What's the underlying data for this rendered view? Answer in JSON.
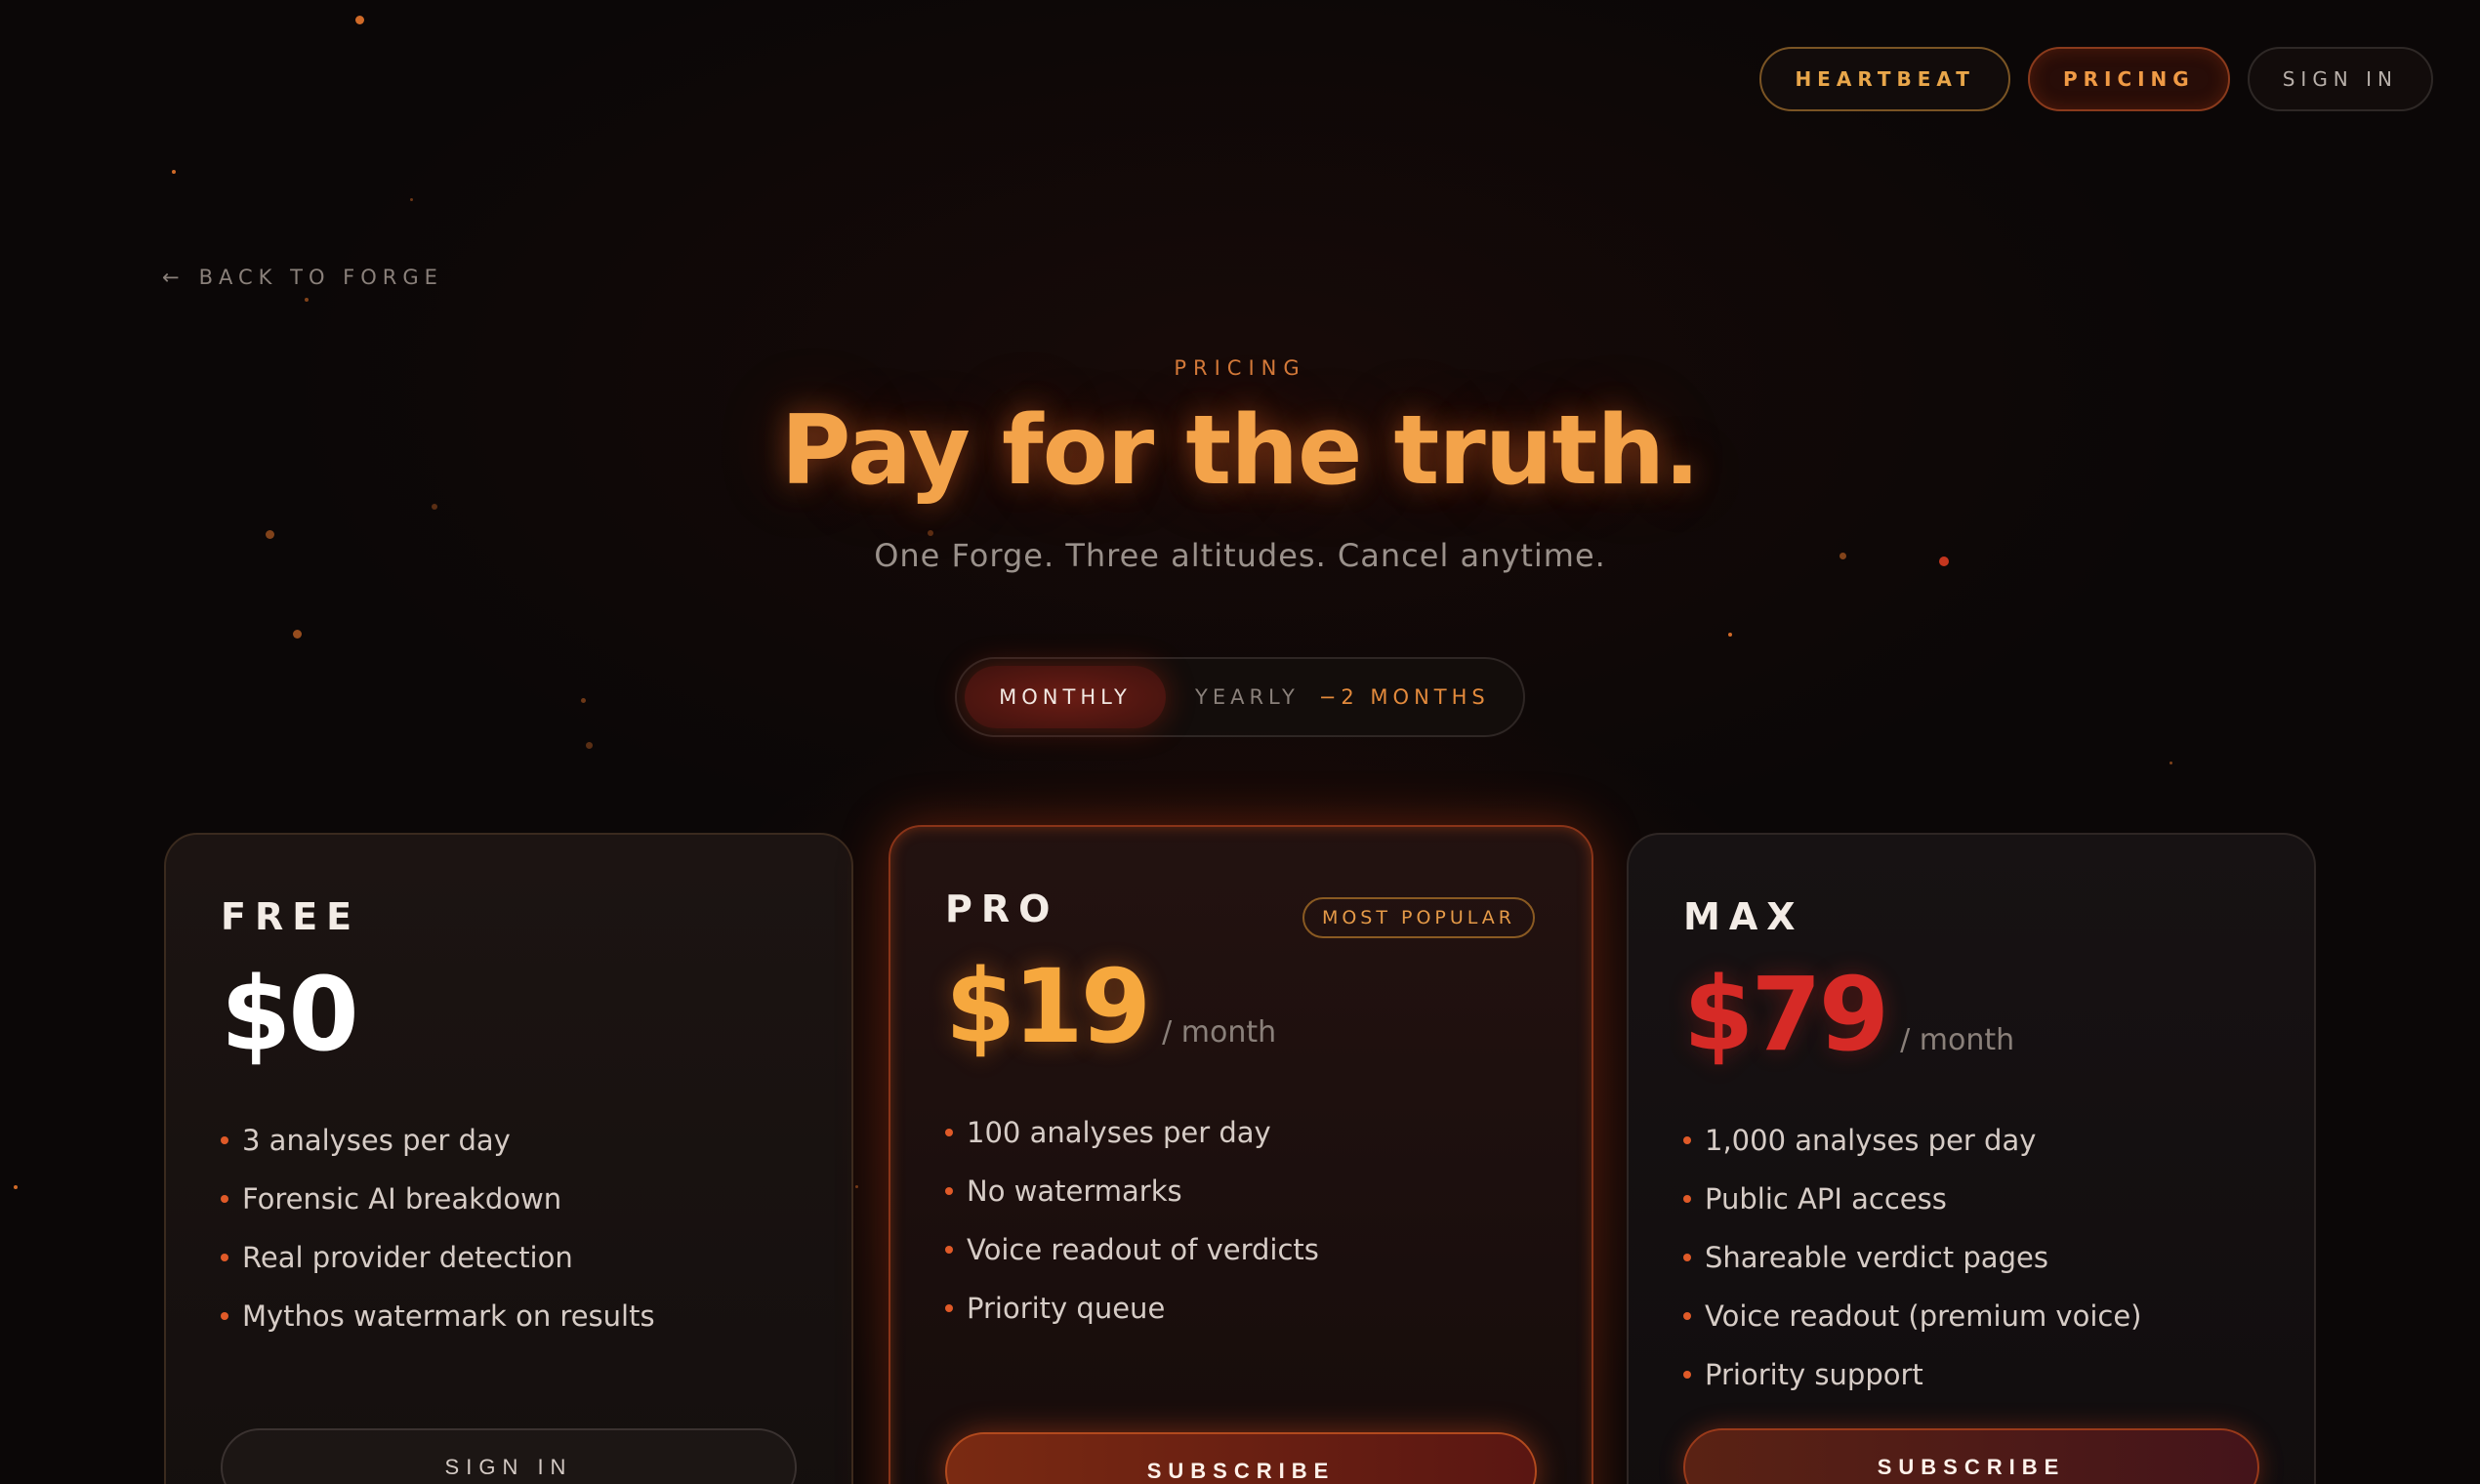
{
  "nav": {
    "heartbeat": "HEARTBEAT",
    "pricing": "PRICING",
    "signin": "SIGN IN"
  },
  "back": {
    "arrow": "←",
    "label": "BACK TO FORGE"
  },
  "hero": {
    "eyebrow": "PRICING",
    "title": "Pay for the truth.",
    "subtitle": "One Forge. Three altitudes. Cancel anytime."
  },
  "billing": {
    "monthly": "MONTHLY",
    "yearly": "YEARLY",
    "yearly_badge": "−2 MONTHS",
    "selected": "MONTHLY"
  },
  "plans": [
    {
      "name": "FREE",
      "price": "$0",
      "period": "",
      "features": [
        "3 analyses per day",
        "Forensic AI breakdown",
        "Real provider detection",
        "Mythos watermark on results"
      ],
      "cta": "SIGN IN"
    },
    {
      "name": "PRO",
      "badge": "MOST POPULAR",
      "price": "$19",
      "period": "/ month",
      "features": [
        "100 analyses per day",
        "No watermarks",
        "Voice readout of verdicts",
        "Priority queue"
      ],
      "cta": "SUBSCRIBE"
    },
    {
      "name": "MAX",
      "price": "$79",
      "period": "/ month",
      "features": [
        "1,000 analyses per day",
        "Public API access",
        "Shareable verdict pages",
        "Voice readout (premium voice)",
        "Priority support"
      ],
      "cta": "SUBSCRIBE"
    }
  ],
  "colors": {
    "accent_orange": "#f3a34a",
    "accent_red": "#d62a26",
    "background": "#0b0707"
  }
}
